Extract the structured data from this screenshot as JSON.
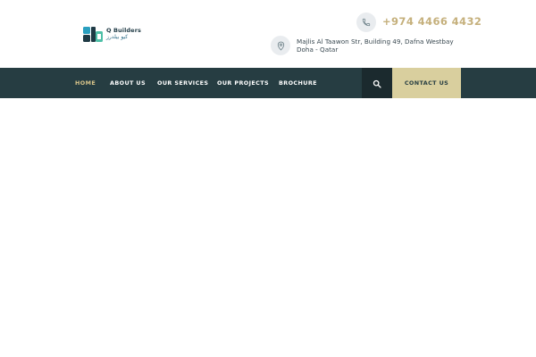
{
  "brand": {
    "name_en": "Q Builders",
    "name_ar": "كيو بيلدرز",
    "logo_colors": [
      "#1f3a45",
      "#2a9fbf",
      "#4fc0a8"
    ]
  },
  "contact": {
    "phone": "+974 4466 4432",
    "address_line1": "Majlis Al Taawon Str, Building 49, Dafna Westbay",
    "address_line2": "Doha - Qatar",
    "phone_icon": "phone-icon",
    "address_icon": "map-pin-icon"
  },
  "nav": {
    "items": [
      {
        "label": "HOME",
        "active": true
      },
      {
        "label": "ABOUT US",
        "active": false
      },
      {
        "label": "OUR SERVICES",
        "active": false
      },
      {
        "label": "OUR PROJECTS",
        "active": false
      },
      {
        "label": "BROCHURE",
        "active": false
      }
    ],
    "search_icon": "search-icon",
    "contact_label": "CONTACT US"
  },
  "colors": {
    "nav_bg": "#263d42",
    "accent_gold": "#c5b07c",
    "contact_bg": "#d9cf9e",
    "search_bg": "#1b2a2e"
  }
}
